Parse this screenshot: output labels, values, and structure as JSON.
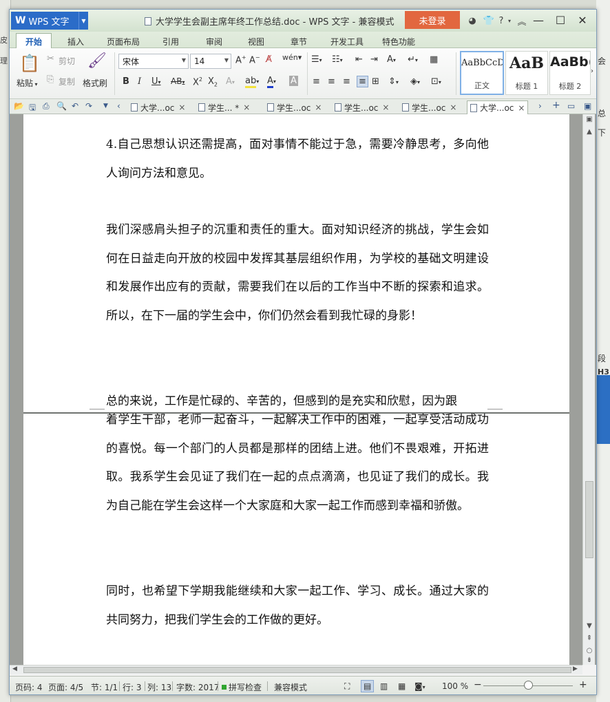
{
  "bg": {
    "left_glyphs": [
      "皮",
      "理"
    ],
    "right_glyphs": [
      "会",
      "总",
      "下",
      "段",
      "H3"
    ]
  },
  "titlebar": {
    "app_name": "WPS 文字",
    "title": "大学学生会副主席年终工作总结.doc - WPS 文字 - 兼容模式",
    "login": "未登录",
    "help": "?"
  },
  "tabs": [
    "开始",
    "插入",
    "页面布局",
    "引用",
    "审阅",
    "视图",
    "章节",
    "开发工具",
    "特色功能"
  ],
  "ribbon": {
    "paste": "粘贴",
    "cut": "剪切",
    "copy": "复制",
    "format_painter": "格式刷",
    "font_name": "宋体",
    "font_size": "14",
    "styles": [
      {
        "sample": "AaBbCcD",
        "name": "正文"
      },
      {
        "sample": "AaB",
        "name": "标题 1"
      },
      {
        "sample": "AaBb(",
        "name": "标题 2"
      }
    ]
  },
  "doc_tabs": [
    {
      "label": "大学...oc",
      "close": "×"
    },
    {
      "label": "学生... *",
      "close": "×"
    },
    {
      "label": "学生...oc",
      "close": "×"
    },
    {
      "label": "学生...oc",
      "close": "×"
    },
    {
      "label": "学生...oc",
      "close": "×"
    },
    {
      "label": "大学...oc",
      "close": "×"
    }
  ],
  "document": {
    "page1": [
      "4.自己思想认识还需提高，面对事情不能过于急，需要冷静思考，多向他人询问方法和意见。",
      "我们深感肩头担子的沉重和责任的重大。面对知识经济的挑战，学生会如何在日益走向开放的校园中发挥其基层组织作用，为学校的基础文明建设和发展作出应有的贡献，需要我们在以后的工作当中不断的探索和追求。所以，在下一届的学生会中，你们仍然会看到我忙碌的身影！",
      "总的来说，工作是忙碌的、辛苦的，但感到的是充实和欣慰，因为跟"
    ],
    "page2": [
      "着学生干部，老师一起奋斗，一起解决工作中的困难，一起享受活动成功的喜悦。每一个部门的人员都是那样的团结上进。他们不畏艰难，开拓进取。我系学生会见证了我们在一起的点点滴滴，也见证了我们的成长。我为自己能在学生会这样一个大家庭和大家一起工作而感到幸福和骄傲。",
      "同时，也希望下学期我能继续和大家一起工作、学习、成长。通过大家的共同努力，把我们学生会的工作做的更好。"
    ]
  },
  "status": {
    "page_code": "页码: 4",
    "pages": "页面: 4/5",
    "section": "节: 1/1",
    "row": "行: 3",
    "col": "列: 13",
    "words": "字数: 2017",
    "spell": "拼写检查",
    "mode": "兼容模式",
    "zoom": "100 %",
    "zoom_fraction": 0.5
  }
}
